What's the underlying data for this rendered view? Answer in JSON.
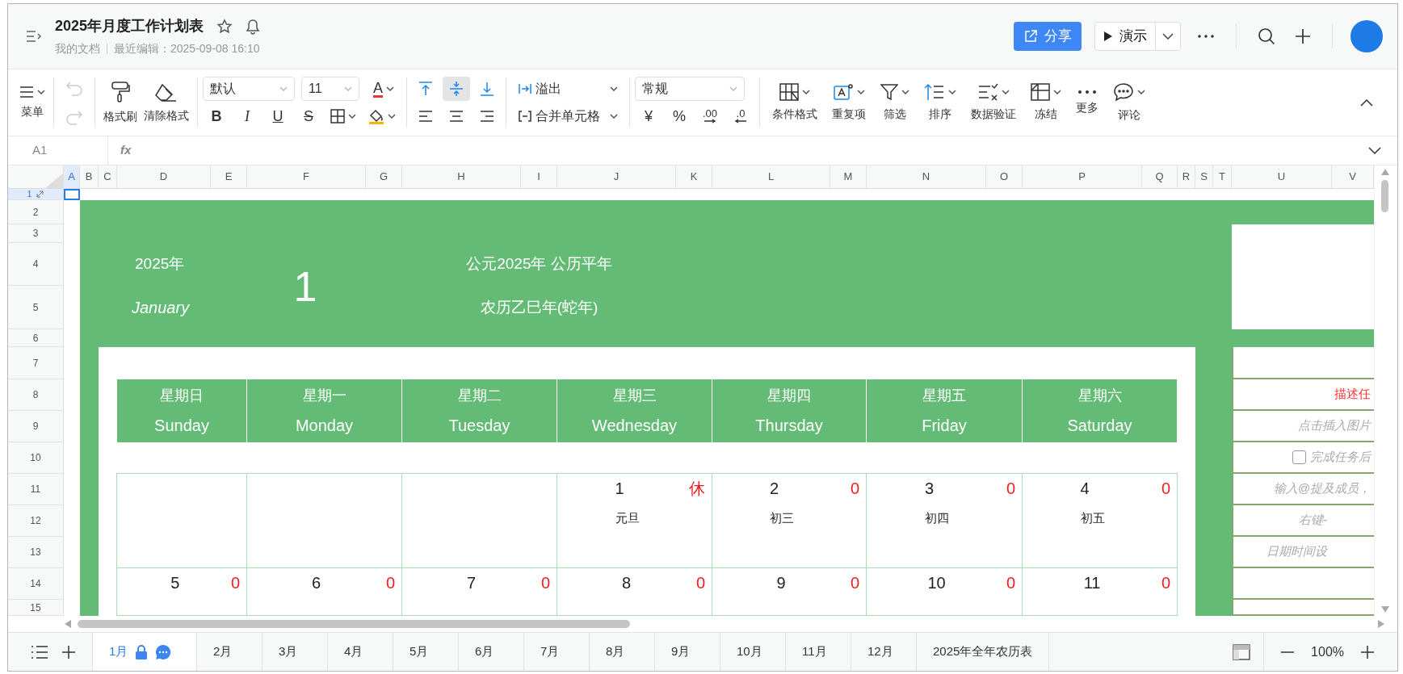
{
  "doc": {
    "title": "2025年月度工作计划表",
    "location": "我的文档",
    "edited": "最近编辑：2025-09-08 16:10"
  },
  "header_buttons": {
    "share": "分享",
    "present": "演示"
  },
  "toolbar": {
    "menu": {
      "label": "菜单"
    },
    "history": [
      {
        "kind": "undo",
        "disabled": true
      },
      {
        "kind": "redo",
        "disabled": true
      }
    ],
    "tools": [
      {
        "label": "格式刷"
      },
      {
        "label": "清除格式"
      }
    ],
    "font": {
      "value": "默认"
    },
    "font_size": {
      "value": "11"
    },
    "font_color": {
      "text": "A"
    },
    "text_styles": [
      "B",
      "I",
      "U",
      "S"
    ],
    "vertical_align": [
      {
        "selected": false
      },
      {
        "selected": true
      },
      {
        "selected": false
      }
    ],
    "wrap": {
      "value": "溢出"
    },
    "merge": {
      "label": "合并单元格"
    },
    "number_format": {
      "value": "常规"
    },
    "currency": "¥",
    "percent": "%",
    "decimals": [
      {
        "kind": "increase",
        "text": ".00"
      },
      {
        "kind": "decrease",
        "text": ".0"
      }
    ],
    "features": [
      {
        "label": "条件格式"
      },
      {
        "label": "重复项"
      },
      {
        "label": "筛选"
      },
      {
        "label": "排序"
      },
      {
        "label": "数据验证"
      },
      {
        "label": "冻结"
      },
      {
        "label": "更多"
      },
      {
        "label": "评论"
      }
    ]
  },
  "formula_bar": {
    "cell": "A1",
    "fx": "fx"
  },
  "columns": [
    {
      "label": "A",
      "selected": true
    },
    {
      "label": "B",
      "selected": false
    },
    {
      "label": "C",
      "selected": false
    },
    {
      "label": "D",
      "selected": false
    },
    {
      "label": "E",
      "selected": false
    },
    {
      "label": "F",
      "selected": false
    },
    {
      "label": "G",
      "selected": false
    },
    {
      "label": "H",
      "selected": false
    },
    {
      "label": "I",
      "selected": false
    },
    {
      "label": "J",
      "selected": false
    },
    {
      "label": "K",
      "selected": false
    },
    {
      "label": "L",
      "selected": false
    },
    {
      "label": "M",
      "selected": false
    },
    {
      "label": "N",
      "selected": false
    },
    {
      "label": "O",
      "selected": false
    },
    {
      "label": "P",
      "selected": false
    },
    {
      "label": "Q",
      "selected": false
    },
    {
      "label": "R",
      "selected": false
    },
    {
      "label": "S",
      "selected": false
    },
    {
      "label": "T",
      "selected": false
    },
    {
      "label": "U",
      "selected": false
    },
    {
      "label": "V",
      "selected": false
    }
  ],
  "rows": [
    {
      "label": "1",
      "selected": true
    },
    {
      "label": "2",
      "selected": false
    },
    {
      "label": "3",
      "selected": false
    },
    {
      "label": "4",
      "selected": false
    },
    {
      "label": "5",
      "selected": false
    },
    {
      "label": "6",
      "selected": false
    },
    {
      "label": "7",
      "selected": false
    },
    {
      "label": "8",
      "selected": false
    },
    {
      "label": "9",
      "selected": false
    },
    {
      "label": "10",
      "selected": false
    },
    {
      "label": "11",
      "selected": false
    },
    {
      "label": "12",
      "selected": false
    },
    {
      "label": "13",
      "selected": false
    },
    {
      "label": "14",
      "selected": false
    },
    {
      "label": "15",
      "selected": false
    }
  ],
  "calendar": {
    "year": "2025年",
    "month_en": "January",
    "month_number": "1",
    "era": "公元2025年 公历平年",
    "lunar_year": "农历乙巳年(蛇年)",
    "weekdays": [
      {
        "cn": "星期日",
        "en": "Sunday"
      },
      {
        "cn": "星期一",
        "en": "Monday"
      },
      {
        "cn": "星期二",
        "en": "Tuesday"
      },
      {
        "cn": "星期三",
        "en": "Wednesday"
      },
      {
        "cn": "星期四",
        "en": "Thursday"
      },
      {
        "cn": "星期五",
        "en": "Friday"
      },
      {
        "cn": "星期六",
        "en": "Saturday"
      }
    ],
    "weeks": [
      [
        {
          "kind": "empty"
        },
        {
          "kind": "empty"
        },
        {
          "kind": "empty"
        },
        {
          "kind": "day",
          "day": "1",
          "mark": "休",
          "lunar": "元旦"
        },
        {
          "kind": "day",
          "day": "2",
          "mark": "0",
          "lunar": "初三"
        },
        {
          "kind": "day",
          "day": "3",
          "mark": "0",
          "lunar": "初四"
        },
        {
          "kind": "day",
          "day": "4",
          "mark": "0",
          "lunar": "初五"
        }
      ],
      [
        {
          "kind": "day",
          "day": "5",
          "mark": "0"
        },
        {
          "kind": "day",
          "day": "6",
          "mark": "0"
        },
        {
          "kind": "day",
          "day": "7",
          "mark": "0"
        },
        {
          "kind": "day",
          "day": "8",
          "mark": "0"
        },
        {
          "kind": "day",
          "day": "9",
          "mark": "0"
        },
        {
          "kind": "day",
          "day": "10",
          "mark": "0"
        },
        {
          "kind": "day",
          "day": "11",
          "mark": "0"
        }
      ]
    ]
  },
  "task_panel": [
    {
      "kind": "heading",
      "text": "描述任"
    },
    {
      "kind": "hint",
      "text": "点击插入图片"
    },
    {
      "kind": "checkbox",
      "text": "完成任务后",
      "checked": false
    },
    {
      "kind": "hint",
      "text": "输入@提及成员，"
    },
    {
      "kind": "hint",
      "text": "右键-"
    },
    {
      "kind": "hint",
      "text": "日期时间设"
    }
  ],
  "sheet_tabs": [
    {
      "label": "1月",
      "selected": true,
      "locked": true,
      "comments": true
    },
    {
      "label": "2月",
      "selected": false,
      "locked": false,
      "comments": false
    },
    {
      "label": "3月",
      "selected": false,
      "locked": false,
      "comments": false
    },
    {
      "label": "4月",
      "selected": false,
      "locked": false,
      "comments": false
    },
    {
      "label": "5月",
      "selected": false,
      "locked": false,
      "comments": false
    },
    {
      "label": "6月",
      "selected": false,
      "locked": false,
      "comments": false
    },
    {
      "label": "7月",
      "selected": false,
      "locked": false,
      "comments": false
    },
    {
      "label": "8月",
      "selected": false,
      "locked": false,
      "comments": false
    },
    {
      "label": "9月",
      "selected": false,
      "locked": false,
      "comments": false
    },
    {
      "label": "10月",
      "selected": false,
      "locked": false,
      "comments": false
    },
    {
      "label": "11月",
      "selected": false,
      "locked": false,
      "comments": false
    },
    {
      "label": "12月",
      "selected": false,
      "locked": false,
      "comments": false
    },
    {
      "label": "2025年全年农历表",
      "selected": false,
      "locked": false,
      "comments": false
    }
  ],
  "zoom": "100%"
}
